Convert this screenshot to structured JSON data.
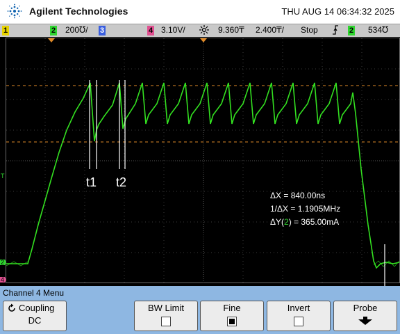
{
  "header": {
    "brand": "Agilent Technologies",
    "datetime": "THU AUG 14 06:34:32 2025",
    "logo_icon": "agilent-spark-icon"
  },
  "status_bar": {
    "ch1_label": "1",
    "ch2_label": "2",
    "ch2_scale": "200℧/",
    "ch3_label": "3",
    "ch4_label": "4",
    "ch4_scale": "3.10V/",
    "trigger_icon": "trigger-sun-icon",
    "time_delay": "9.360₸",
    "time_scale": "2.400₸/",
    "run_state": "Stop",
    "edge_icon": "rising-edge-icon",
    "trig_channel": "2",
    "trig_level": "534℧"
  },
  "markers": {
    "t1": "t1",
    "t2": "t2"
  },
  "measurements": {
    "dx": "ΔX = 840.00ns",
    "inv_dx": "1/ΔX = 1.1905MHz",
    "dy_prefix": "ΔY(",
    "dy_channel": "2",
    "dy_suffix": ") = 365.00mA"
  },
  "screen_markers": {
    "ground_ch2": "2",
    "ground_ch4": "4",
    "trigger_level": "T"
  },
  "menu": {
    "title": "Channel 4  Menu",
    "coupling_label": "Coupling",
    "coupling_value": "DC",
    "coupling_icon": "cycle-arrow-icon",
    "bw_limit_label": "BW Limit",
    "bw_limit_checked": false,
    "fine_label": "Fine",
    "fine_checked": true,
    "invert_label": "Invert",
    "invert_checked": false,
    "probe_label": "Probe",
    "probe_icon": "down-arrow-icon"
  },
  "colors": {
    "trace": "#33e020",
    "cursor_orange": "#e08a28",
    "ch2": "#2fd52f",
    "ch4": "#e05090"
  }
}
